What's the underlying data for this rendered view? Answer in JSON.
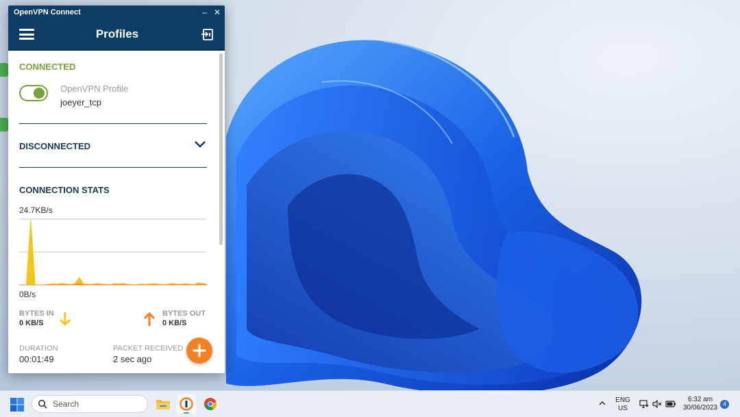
{
  "window": {
    "title": "OpenVPN Connect",
    "minimize_glyph": "–",
    "close_glyph": "✕"
  },
  "header": {
    "title": "Profiles",
    "menu_icon": "hamburger-icon",
    "import_icon": "import-profile-icon"
  },
  "connected": {
    "section_label": "CONNECTED",
    "profile_type": "OpenVPN Profile",
    "profile_name": "joeyer_tcp",
    "toggle_on": true
  },
  "disconnected": {
    "section_label": "DISCONNECTED"
  },
  "stats": {
    "section_label": "CONNECTION STATS",
    "bytes_in_label": "BYTES IN",
    "bytes_in_value": "0 KB/S",
    "bytes_out_label": "BYTES OUT",
    "bytes_out_value": "0 KB/S",
    "duration_label": "DURATION",
    "duration_value": "00:01:49",
    "packet_label": "PACKET RECEIVED",
    "packet_value": "2 sec ago"
  },
  "chart_data": {
    "type": "area",
    "ymax_label": "24.7KB/s",
    "ymin_label": "0B/s",
    "ylim": [
      0,
      24.7
    ],
    "series": [
      {
        "color": "#f5c518",
        "values": [
          0,
          0,
          24.7,
          0,
          0,
          0,
          0.2,
          0.5,
          0.3,
          0.6,
          0.4,
          0.2,
          0.5,
          2.8,
          0.4,
          0.3,
          0.2,
          0.6,
          0.3,
          0.2,
          0.1,
          0.5,
          0.4,
          0.6,
          0.2,
          0.1,
          0.1,
          0.3,
          0.2,
          0.4,
          0.5,
          0.3,
          0.1,
          0.2,
          0.6,
          0.4,
          0.2,
          0.5,
          0.3,
          0.1,
          0.8,
          0.6,
          0.2
        ]
      },
      {
        "color": "#f5801f",
        "values": [
          0,
          0,
          0,
          0,
          0,
          0,
          0.1,
          0.2,
          0.1,
          0.2,
          0.1,
          0.1,
          0.2,
          0.5,
          0.1,
          0.1,
          0.1,
          0.2,
          0.1,
          0.1,
          0,
          0.2,
          0.1,
          0.2,
          0.1,
          0,
          0,
          0.1,
          0.1,
          0.1,
          0.2,
          0.1,
          0,
          0.1,
          0.2,
          0.1,
          0.1,
          0.2,
          0.1,
          0,
          0.3,
          0.2,
          0.1
        ]
      }
    ]
  },
  "colors": {
    "header_bg": "#0d3d64",
    "connected_green": "#7aa23c",
    "accent_orange": "#f5801f",
    "bytes_in_yellow": "#f5c518",
    "navy_text": "#1b3a5a"
  },
  "taskbar": {
    "search_placeholder": "Search",
    "start_icon": "windows-start-icon",
    "apps": [
      "file-explorer-icon",
      "openvpn-connect-icon",
      "chrome-icon"
    ],
    "lang_top": "ENG",
    "lang_bottom": "US",
    "time": "6:32 am",
    "date": "30/06/2023",
    "notification_count": "4"
  }
}
